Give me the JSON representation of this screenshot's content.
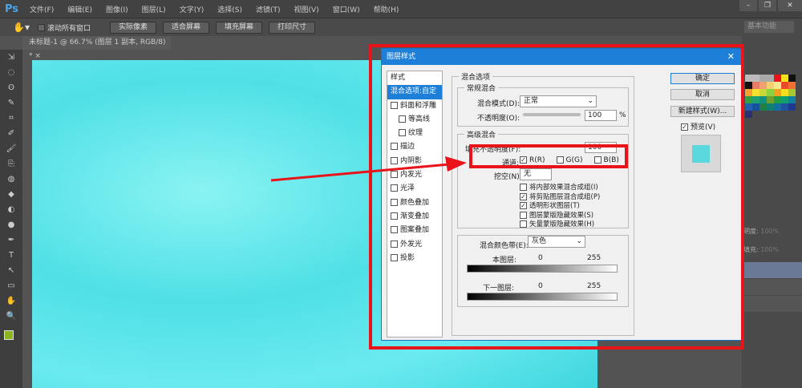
{
  "app": {
    "logo": "Ps",
    "menus": [
      "文件(F)",
      "编辑(E)",
      "图像(I)",
      "图层(L)",
      "文字(Y)",
      "选择(S)",
      "滤镜(T)",
      "视图(V)",
      "窗口(W)",
      "帮助(H)"
    ],
    "window_controls": [
      "–",
      "❐",
      "✕"
    ]
  },
  "options": {
    "scroll_all": "滚动所有窗口",
    "buttons": [
      "实际像素",
      "适合屏幕",
      "填充屏幕",
      "打印尺寸"
    ],
    "workspace": "基本功能"
  },
  "document": {
    "tab": "未标题-1 @ 66.7% (图层 1 副本, RGB/8) *",
    "close": "×"
  },
  "tools": [
    "⇲",
    "◌",
    "ʘ",
    "✎",
    "⌗",
    "✐",
    "🖌",
    "⎘",
    "◍",
    "◆",
    "◐",
    "●",
    "✒",
    "T",
    "↖",
    "▭",
    "✋",
    "🔍"
  ],
  "layers_panel": {
    "opacity_label": "明度:",
    "opacity": "100%",
    "fill_label": "填充:",
    "fill": "100%"
  },
  "colors": {
    "accent": "#1e7fd8",
    "annotation": "#e8141a",
    "canvas": "#5ee4ea"
  },
  "dialog": {
    "title": "图层样式",
    "close": "✕",
    "styles_header": "样式",
    "styles": [
      {
        "label": "混合选项:自定",
        "selected": true
      },
      {
        "label": "斜面和浮雕"
      },
      {
        "label": "等高线",
        "sub": true
      },
      {
        "label": "纹理",
        "sub": true
      },
      {
        "label": "描边"
      },
      {
        "label": "内阴影"
      },
      {
        "label": "内发光"
      },
      {
        "label": "光泽"
      },
      {
        "label": "颜色叠加"
      },
      {
        "label": "渐变叠加"
      },
      {
        "label": "图案叠加"
      },
      {
        "label": "外发光"
      },
      {
        "label": "投影"
      }
    ],
    "blend_options": "混合选项",
    "general": {
      "title": "常规混合",
      "mode_label": "混合模式(D):",
      "mode": "正常",
      "opacity_label": "不透明度(O):",
      "opacity": "100",
      "unit": "%"
    },
    "advanced": {
      "title": "高级混合",
      "fill_label": "填充不透明度(F):",
      "fill": "100",
      "channels_label": "通道:",
      "channels": [
        {
          "label": "R(R)",
          "checked": true
        },
        {
          "label": "G(G)",
          "checked": false
        },
        {
          "label": "B(B)",
          "checked": false
        }
      ],
      "knockout_label": "挖空(N):",
      "knockout": "无",
      "options": [
        {
          "label": "将内部效果混合成组(I)",
          "checked": false
        },
        {
          "label": "将剪贴图层混合成组(P)",
          "checked": true
        },
        {
          "label": "透明形状图层(T)",
          "checked": true
        },
        {
          "label": "图层蒙版隐藏效果(S)",
          "checked": false
        },
        {
          "label": "矢量蒙版隐藏效果(H)",
          "checked": false
        }
      ]
    },
    "blend_if": {
      "label": "混合颜色带(E):",
      "value": "灰色",
      "this_layer": "本图层:",
      "underlying": "下一图层:",
      "min": "0",
      "max": "255"
    },
    "buttons": {
      "ok": "确定",
      "cancel": "取消",
      "new_style": "新建样式(W)...",
      "preview": "预览(V)"
    }
  }
}
